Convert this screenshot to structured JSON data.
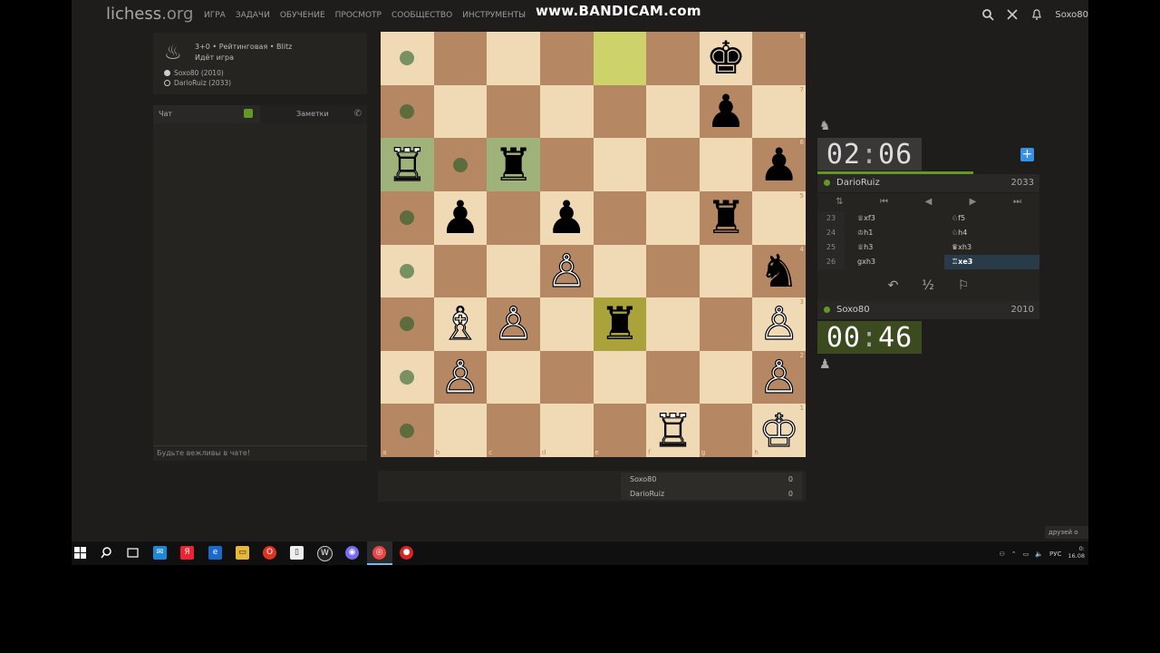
{
  "site": {
    "logo_main": "lichess",
    "logo_tld": ".org"
  },
  "nav": [
    "ИГРА",
    "ЗАДАЧИ",
    "ОБУЧЕНИЕ",
    "ПРОСМОТР",
    "СООБЩЕСТВО",
    "ИНСТРУМЕНТЫ"
  ],
  "watermark": "www.BANDICAM.com",
  "user": {
    "name": "Soxo80"
  },
  "game": {
    "line1": "3+0 • Рейтинговая • Blitz",
    "line2": "Идёт игра",
    "white_player": "Soxo80 (2010)",
    "black_player": "DarioRuiz (2033)"
  },
  "chat": {
    "tab_chat": "Чат",
    "tab_notes": "Заметки",
    "placeholder": "Будьте вежливы в чате!"
  },
  "board": {
    "ranks": [
      "8",
      "7",
      "6",
      "5",
      "4",
      "3",
      "2",
      "1"
    ],
    "files": [
      "a",
      "b",
      "c",
      "d",
      "e",
      "f",
      "g",
      "h"
    ],
    "pieces": {
      "g8": "♚",
      "g7": "♟",
      "h6": "♟",
      "b5": "♟",
      "d5": "♟",
      "g5": "♜",
      "h4": "♞",
      "e3": "♜",
      "c6": "♜",
      "a6": "♖",
      "d4": "♙",
      "b3": "♗",
      "c3": "♙",
      "h3": "♙",
      "b2": "♙",
      "h2": "♙",
      "f1": "♖",
      "h1": "♔"
    },
    "piece_colors": {
      "g8": "b",
      "g7": "b",
      "h6": "b",
      "b5": "b",
      "d5": "b",
      "g5": "b",
      "h4": "b",
      "e3": "b",
      "c6": "b",
      "a6": "w",
      "d4": "w",
      "b3": "w",
      "c3": "w",
      "h3": "w",
      "b2": "w",
      "h2": "w",
      "f1": "w",
      "h1": "w"
    },
    "last_move": [
      "e8",
      "e3"
    ],
    "selected": [
      "a6",
      "c6"
    ],
    "move_dots": [
      "a8",
      "a7",
      "b6",
      "a5",
      "a4",
      "a3",
      "a2",
      "a1"
    ]
  },
  "score": {
    "rows": [
      {
        "name": "Soxo80",
        "score": "0"
      },
      {
        "name": "DarioRuiz",
        "score": "0"
      }
    ]
  },
  "clocks": {
    "top": {
      "min": "02",
      "sec": "06"
    },
    "bottom": {
      "min": "00",
      "sec": "46"
    }
  },
  "players": {
    "top": {
      "name": "DarioRuiz",
      "rating": "2033"
    },
    "bottom": {
      "name": "Soxo80",
      "rating": "2010"
    }
  },
  "time_progress": 0.7,
  "controls": [
    "⇅",
    "⏮",
    "◀",
    "▶",
    "⏭"
  ],
  "moves": [
    {
      "n": "23",
      "w": "♕xf3",
      "b": "♘f5"
    },
    {
      "n": "24",
      "w": "♔h1",
      "b": "♘h4"
    },
    {
      "n": "25",
      "w": "♕h3",
      "b": "♛xh3"
    },
    {
      "n": "26",
      "w": "gxh3",
      "b": "♖xe3"
    }
  ],
  "actions": {
    "takeback": "↶",
    "draw": "½",
    "resign": "⚐"
  },
  "friends_tab": "друзей о",
  "tray": {
    "lang": "РУС",
    "time": "0:",
    "date": "16.08"
  }
}
